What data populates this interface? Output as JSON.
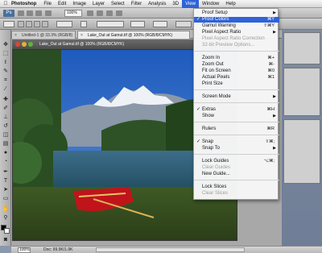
{
  "menubar": {
    "apple": "",
    "app": "Photoshop",
    "items": [
      "File",
      "Edit",
      "Image",
      "Layer",
      "Select",
      "Filter",
      "Analysis",
      "3D",
      "View",
      "Window",
      "Help"
    ],
    "active": "View"
  },
  "appbar": {
    "logo": "Ps",
    "zoom_value": "100%",
    "colors": {
      "accent": "#2f63d8"
    }
  },
  "tabs": [
    {
      "label": "Untitled-1 @ 33.3% (RGB/8)"
    },
    {
      "label": "Lake_Out at Gamut.tif @ 100% (RGB/8/CMYK)"
    }
  ],
  "doc_window": {
    "title": "Lake_Out at Gamut.tif @ 100% (RGB/8/CMYK)"
  },
  "status": {
    "zoom": "100%",
    "doc": "Doc: 99.9K/1.9K"
  },
  "view_menu": {
    "items": [
      {
        "label": "Proof Setup",
        "arrow": "▶"
      },
      {
        "label": "Proof Colors",
        "shortcut": "⌘Y",
        "check": "✓",
        "highlighted": true
      },
      {
        "label": "Gamut Warning",
        "shortcut": "⇧⌘Y"
      },
      {
        "label": "Pixel Aspect Ratio",
        "arrow": "▶"
      },
      {
        "label": "Pixel Aspect Ratio Correction",
        "disabled": true
      },
      {
        "label": "32-bit Preview Options...",
        "disabled": true
      },
      {
        "label": "Zoom In",
        "shortcut": "⌘+"
      },
      {
        "label": "Zoom Out",
        "shortcut": "⌘-"
      },
      {
        "label": "Fit on Screen",
        "shortcut": "⌘0"
      },
      {
        "label": "Actual Pixels",
        "shortcut": "⌘1"
      },
      {
        "label": "Print Size"
      },
      {
        "label": "Screen Mode",
        "arrow": "▶"
      },
      {
        "label": "Extras",
        "shortcut": "⌘H",
        "check": "✓"
      },
      {
        "label": "Show",
        "arrow": "▶"
      },
      {
        "label": "Rulers",
        "shortcut": "⌘R"
      },
      {
        "label": "Snap",
        "shortcut": "⇧⌘;",
        "check": "✓"
      },
      {
        "label": "Snap To",
        "arrow": "▶"
      },
      {
        "label": "Lock Guides",
        "shortcut": "⌥⌘;"
      },
      {
        "label": "Clear Guides",
        "disabled": true
      },
      {
        "label": "New Guide..."
      },
      {
        "label": "Lock Slices"
      },
      {
        "label": "Clear Slices",
        "disabled": true
      }
    ]
  }
}
